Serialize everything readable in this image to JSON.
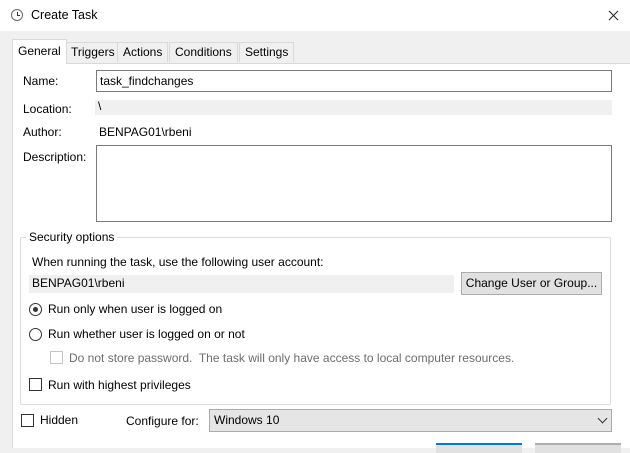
{
  "window": {
    "title": "Create Task"
  },
  "tabs": [
    {
      "label": "General"
    },
    {
      "label": "Triggers"
    },
    {
      "label": "Actions"
    },
    {
      "label": "Conditions"
    },
    {
      "label": "Settings"
    }
  ],
  "general": {
    "name_label": "Name:",
    "name_value": "task_findchanges",
    "location_label": "Location:",
    "location_value": "\\",
    "author_label": "Author:",
    "author_value": "BENPAG01\\rbeni",
    "description_label": "Description:",
    "description_value": ""
  },
  "security": {
    "title": "Security options",
    "account_prompt": "When running the task, use the following user account:",
    "account_value": "BENPAG01\\rbeni",
    "change_button": "Change User or Group...",
    "radio_logged_on": "Run only when user is logged on",
    "radio_logged_on_selected": true,
    "radio_whether": "Run whether user is logged on or not",
    "no_store_password": "Do not store password.  The task will only have access to local computer resources.",
    "highest_privileges": "Run with highest privileges"
  },
  "footer": {
    "hidden_label": "Hidden",
    "configure_label": "Configure for:",
    "configure_value": "Windows 10"
  }
}
